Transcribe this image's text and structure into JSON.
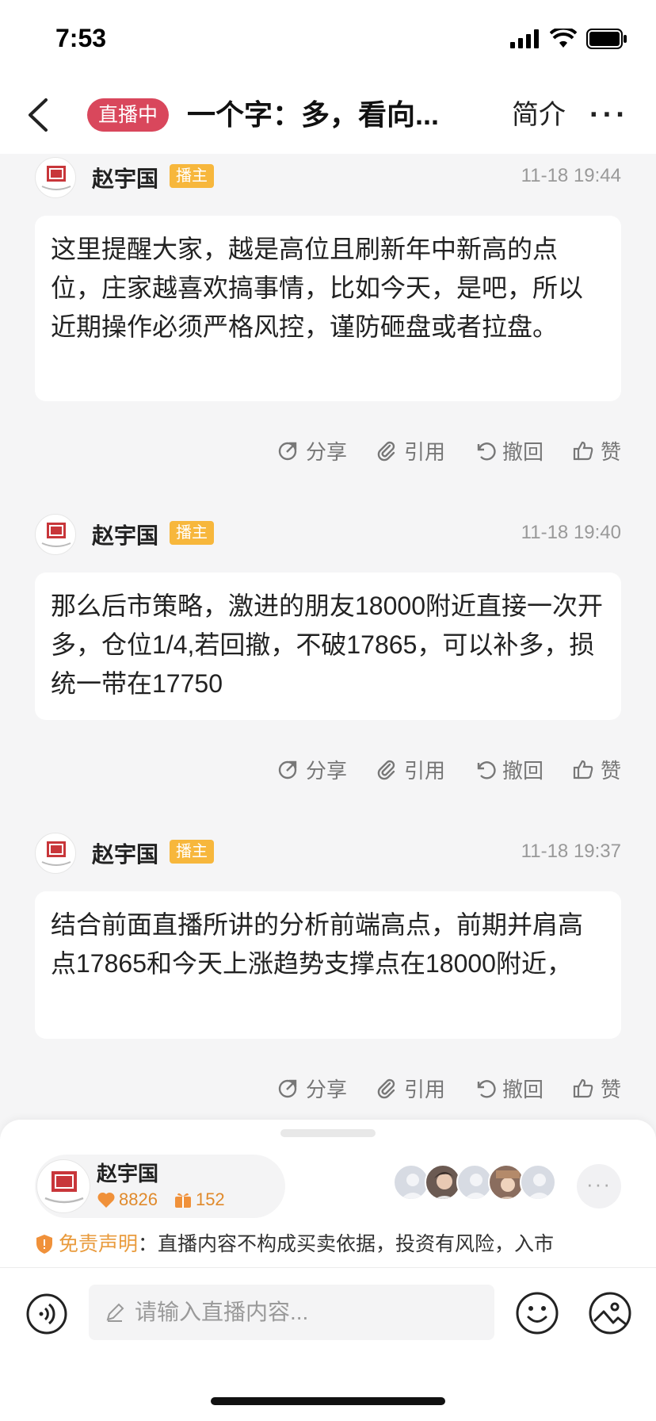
{
  "status_bar": {
    "time": "7:53"
  },
  "nav": {
    "live_badge": "直播中",
    "title": "一个字：多，看向...",
    "intro": "简介",
    "more": "···"
  },
  "messages": [
    {
      "author": "赵宇国",
      "tag": "播主",
      "time": "11-18 19:44",
      "content": "这里提醒大家，越是高位且刷新年中新高的点位，庄家越喜欢搞事情，比如今天，是吧，所以近期操作必须严格风控，谨防砸盘或者拉盘。"
    },
    {
      "author": "赵宇国",
      "tag": "播主",
      "time": "11-18 19:40",
      "content": "那么后市策略，激进的朋友18000附近直接一次开多，仓位1/4,若回撤，不破17865，可以补多，损统一带在17750"
    },
    {
      "author": "赵宇国",
      "tag": "播主",
      "time": "11-18 19:37",
      "content": "结合前面直播所讲的分析前端高点，前期并肩高点17865和今天上涨趋势支撑点在18000附近，"
    }
  ],
  "actions": {
    "share": "分享",
    "quote": "引用",
    "withdraw": "撤回",
    "like": "赞"
  },
  "host": {
    "name": "赵宇国",
    "likes": "8826",
    "gifts": "152"
  },
  "more_label": "···",
  "disclaimer": {
    "label": "免责声明",
    "text": "：直播内容不构成买卖依据，投资有风险，入市"
  },
  "input": {
    "placeholder": "请输入直播内容..."
  },
  "colors": {
    "live_badge": "#d9475c",
    "host_tag": "#f7b73c",
    "disclaimer_label": "#e99b3d"
  }
}
